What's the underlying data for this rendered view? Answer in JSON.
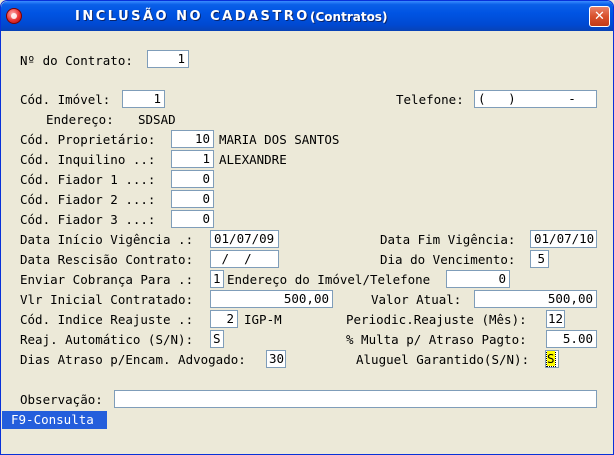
{
  "window": {
    "title": "INCLUSÃO NO CADASTRO",
    "subtitle": "(Contratos)",
    "close_glyph": "✕",
    "app_icon": "red-disc-icon"
  },
  "form": {
    "contrato": {
      "label": "Nº do Contrato:",
      "value": "1"
    },
    "imovel": {
      "label": "Cód. Imóvel:",
      "value": "1"
    },
    "telefone": {
      "label": "Telefone:",
      "value": "(   )       -"
    },
    "endereco": {
      "label": "Endereço:",
      "value": "SDSAD"
    },
    "proprietario": {
      "label": "Cód. Proprietário:",
      "code": "10",
      "name": "MARIA DOS SANTOS"
    },
    "inquilino": {
      "label": "Cód. Inquilino ..:",
      "code": "1",
      "name": "ALEXANDRE"
    },
    "fiador1": {
      "label": "Cód. Fiador 1 ...:",
      "value": "0"
    },
    "fiador2": {
      "label": "Cód. Fiador 2 ...:",
      "value": "0"
    },
    "fiador3": {
      "label": "Cód. Fiador 3 ...:",
      "value": "0"
    },
    "inicio_vigencia": {
      "label": "Data Início Vigência .:",
      "value": "01/07/09"
    },
    "fim_vigencia": {
      "label": "Data Fim Vigência:",
      "value": "01/07/10"
    },
    "rescisao": {
      "label": "Data Rescisão Contrato:",
      "value": " /  /"
    },
    "vencimento": {
      "label": "Dia do Vencimento:",
      "value": "5"
    },
    "cobranca": {
      "label": "Enviar Cobrança Para .:",
      "value": "1",
      "desc": "Endereço do Imóvel/Telefone",
      "extra": "0"
    },
    "vlr_inicial": {
      "label": "Vlr Inicial Contratado:",
      "value": "500,00"
    },
    "valor_atual": {
      "label": "Valor Atual:",
      "value": "500,00"
    },
    "indice": {
      "label": "Cód. Indice Reajuste .:",
      "value": "2",
      "desc": "IGP-M"
    },
    "periodic": {
      "label": "Periodic.Reajuste (Mês):",
      "value": "12"
    },
    "reaj_auto": {
      "label": "Reaj. Automático (S/N):",
      "value": "S"
    },
    "multa": {
      "label": "% Multa p/ Atraso Pagto:",
      "value": "5.00"
    },
    "dias_atraso": {
      "label": "Dias Atraso p/Encam. Advogado:",
      "value": "30"
    },
    "aluguel_garantido": {
      "label": "Aluguel Garantido(S/N):",
      "value": "S"
    },
    "observacao": {
      "label": "Observação:",
      "value": ""
    }
  },
  "status": {
    "hint": "F9-Consulta"
  },
  "colors": {
    "titlebar": "#0054E3",
    "window_bg": "#ECE9D8",
    "status_bg": "#245EDC",
    "focus_highlight": "#FFFF00"
  }
}
